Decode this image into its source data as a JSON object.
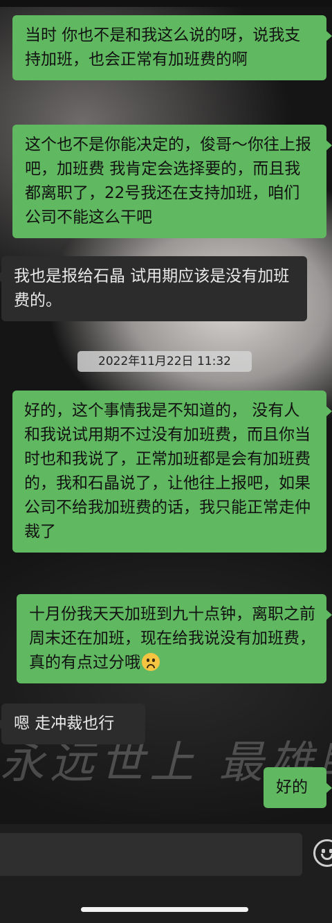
{
  "wallpaper": {
    "text": "永远世上 最雄眼的光"
  },
  "messages": [
    {
      "side": "right",
      "text": "当时 你也不是和我这么说的呀，说我支持加班，也会正常有加班费的啊"
    },
    {
      "side": "right",
      "text": "这个也不是你能决定的，俊哥～你往上报吧，加班费 我肯定会选择要的，而且我都离职了，22号我还在支持加班，咱们公司不能这么干吧"
    },
    {
      "side": "left",
      "text": "我也是报给石晶  试用期应该是没有加班费的。"
    },
    {
      "side": "right",
      "text": "好的，这个事情我是不知道的， 没有人和我说试用期不过没有加班费，而且你当时也和我说了，正常加班都是会有加班费的，我和石晶说了，让他往上报吧，如果公司不给我加班费的话，我只能正常走仲裁了"
    },
    {
      "side": "right",
      "text": "十月份我天天加班到九十点钟，离职之前周末还在加班，现在给我说没有加班费，真的有点过分哦",
      "emoji": "frown-emoji"
    },
    {
      "side": "left",
      "text": "嗯 走冲裁也行"
    },
    {
      "side": "right",
      "text": "好的"
    }
  ],
  "timestamp": "2022年11月22日 11:32",
  "input": {
    "placeholder": ""
  },
  "icons": {
    "emoji_button": "smile-icon"
  },
  "colors": {
    "sent_bubble": "#60b860",
    "received_bubble": "#2c2c2c"
  }
}
